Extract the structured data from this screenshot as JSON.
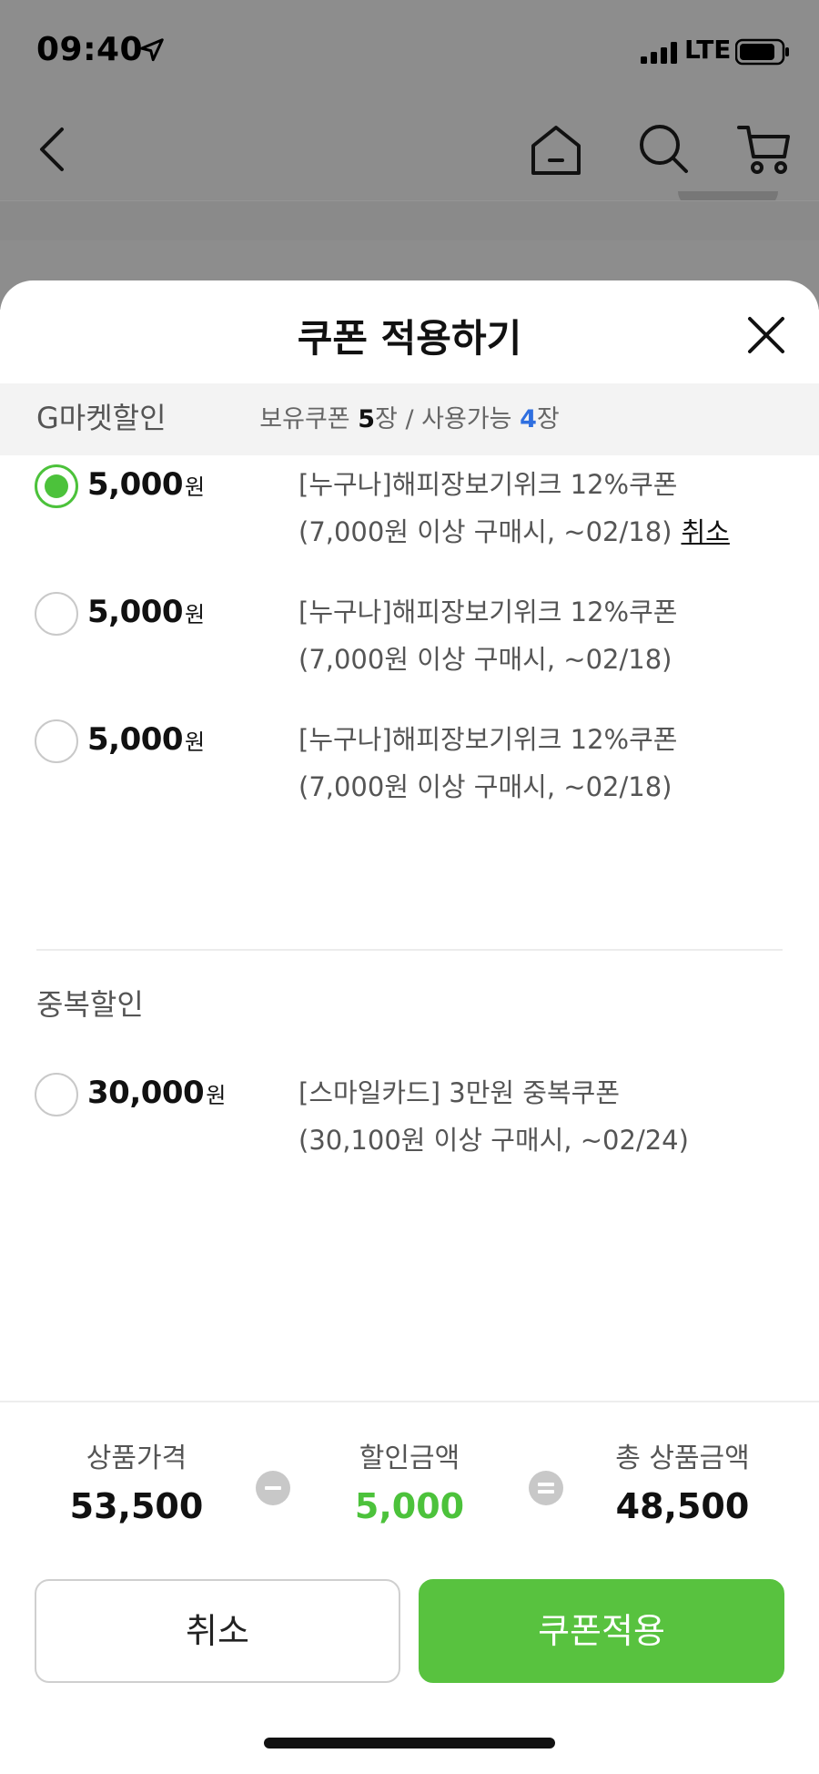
{
  "status_bar": {
    "time": "09:40",
    "network": "LTE",
    "icons": [
      "location-arrow-icon",
      "signal-icon",
      "battery-icon"
    ]
  },
  "nav": {
    "icons": [
      "back-icon",
      "home-icon",
      "search-icon",
      "cart-icon"
    ]
  },
  "sheet": {
    "title": "쿠폰 적용하기",
    "close_icon": "close-icon",
    "summary": {
      "owned_label": "보유쿠폰 ",
      "owned_count": "5",
      "owned_unit": "장 / 사용가능 ",
      "available_count": "4",
      "available_unit": "장"
    },
    "sections": [
      {
        "title": "G마켓할인",
        "coupons": [
          {
            "amount": "5,000",
            "unit": "원",
            "name": "[누구나]해피장보기위크 12%쿠폰",
            "condition": "(7,000원 이상 구매시, ~02/18)",
            "action": "취소",
            "selected": true
          },
          {
            "amount": "5,000",
            "unit": "원",
            "name": "[누구나]해피장보기위크 12%쿠폰",
            "condition": "(7,000원 이상 구매시, ~02/18)",
            "selected": false
          },
          {
            "amount": "5,000",
            "unit": "원",
            "name": "[누구나]해피장보기위크 12%쿠폰",
            "condition": "(7,000원 이상 구매시, ~02/18)",
            "selected": false
          }
        ]
      },
      {
        "title": "중복할인",
        "coupons": [
          {
            "amount": "30,000",
            "unit": "원",
            "name": "[스마일카드] 3만원 중복쿠폰",
            "condition": "(30,100원 이상 구매시, ~02/24)",
            "selected": false
          }
        ]
      }
    ],
    "totals": {
      "product_price_label": "상품가격",
      "product_price": "53,500",
      "discount_label": "할인금액",
      "discount": "5,000",
      "total_label": "총 상품금액",
      "total": "48,500"
    },
    "buttons": {
      "cancel": "취소",
      "apply": "쿠폰적용"
    }
  },
  "colors": {
    "accent_green": "#58c23f",
    "link_blue": "#2f6fe0",
    "overlay_gray": "#8d8d8d"
  }
}
